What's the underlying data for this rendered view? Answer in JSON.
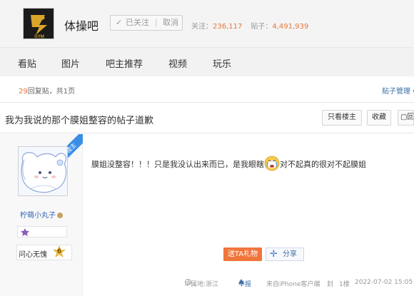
{
  "header": {
    "forum_name": "体操吧",
    "logo_text": "GYM",
    "follow": {
      "check_icon": "check-icon",
      "followed_label": "已关注",
      "separator": "|",
      "cancel_label": "取消"
    },
    "stats": {
      "followers_label": "关注：",
      "followers": "236,117",
      "posts_label": "贴子：",
      "posts": "4,491,939"
    }
  },
  "nav": {
    "items": [
      "看贴",
      "图片",
      "吧主推荐",
      "视频",
      "玩乐"
    ]
  },
  "reply_bar": {
    "count": "29",
    "count_suffix": "回复贴，共",
    "pages": "1",
    "pages_suffix": "页",
    "manage_label": "贴子管理"
  },
  "title_bar": {
    "title": "我为我说的那个膜姐整容的帖子道歉",
    "buttons": {
      "only_op": "只看楼主",
      "collect": "收藏",
      "reply": "回"
    }
  },
  "author": {
    "op_tag": "楼主",
    "name": "柠萌小丸子",
    "level_title": "问心无愧",
    "level": "6"
  },
  "post": {
    "text_before": "膜姐没整容！！！只是我没认出来而已，是我眼瞎",
    "emoji_icon": "crying-emoji-icon",
    "text_after": "对不起真的很对不起膜姐",
    "gift_label": "送TA礼物",
    "share_label": "分享"
  },
  "meta": {
    "ip_location": "IP属地:浙江",
    "report_label": "举报",
    "client": "来自iPhone客户端",
    "seal": "封",
    "floor": "1楼",
    "datetime": "2022-07-02 15:05"
  },
  "colors": {
    "accent_orange": "#f0753b",
    "link_blue": "#2d64b3",
    "op_blue": "#3a8ee6"
  }
}
